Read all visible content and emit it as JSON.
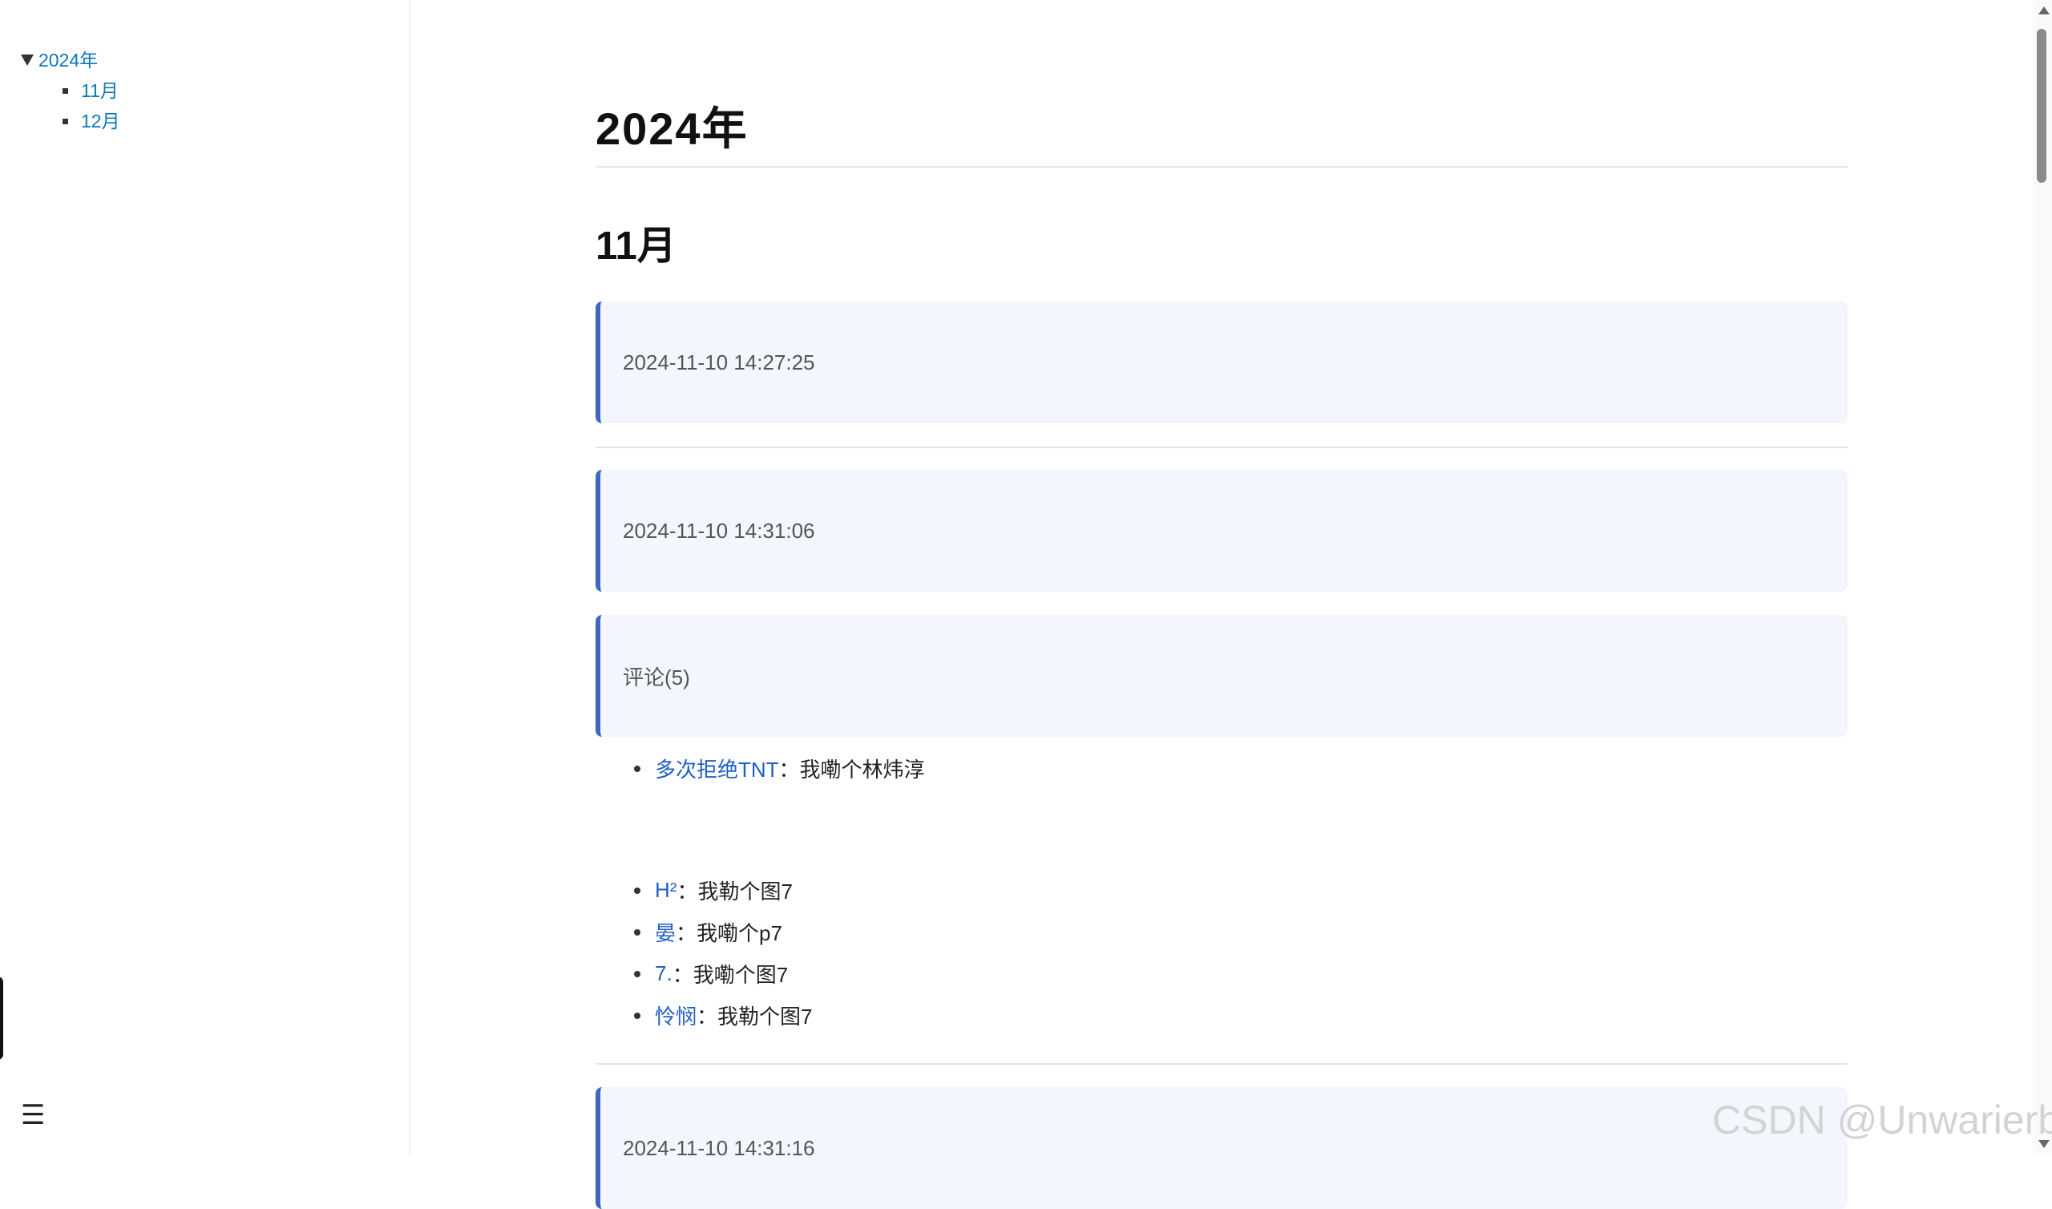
{
  "toc": {
    "year": "2024年",
    "months": [
      "11月",
      "12月"
    ]
  },
  "main": {
    "title": "2024年",
    "section_title": "11月",
    "cards": [
      "2024-11-10 14:27:25",
      "2024-11-10 14:31:06",
      "评论(5)",
      "2024-11-10 14:31:16"
    ],
    "comments": [
      {
        "user": "多次拒绝TNT",
        "text": "：我嘞个林炜淳"
      },
      {
        "user": "H²",
        "text": "：我勒个图7"
      },
      {
        "user": "晏",
        "text": "：我嘞个p7"
      },
      {
        "user": "7.",
        "text": "：我嘞个图7"
      },
      {
        "user": "怜悯",
        "text": "：我勒个图7"
      }
    ]
  },
  "menu_icon": "☰",
  "watermark": "CSDN @Unwarierbl",
  "colors": {
    "link": "#0b78b8",
    "card_bg": "#f3f6fd",
    "card_border": "#3b66c4"
  }
}
